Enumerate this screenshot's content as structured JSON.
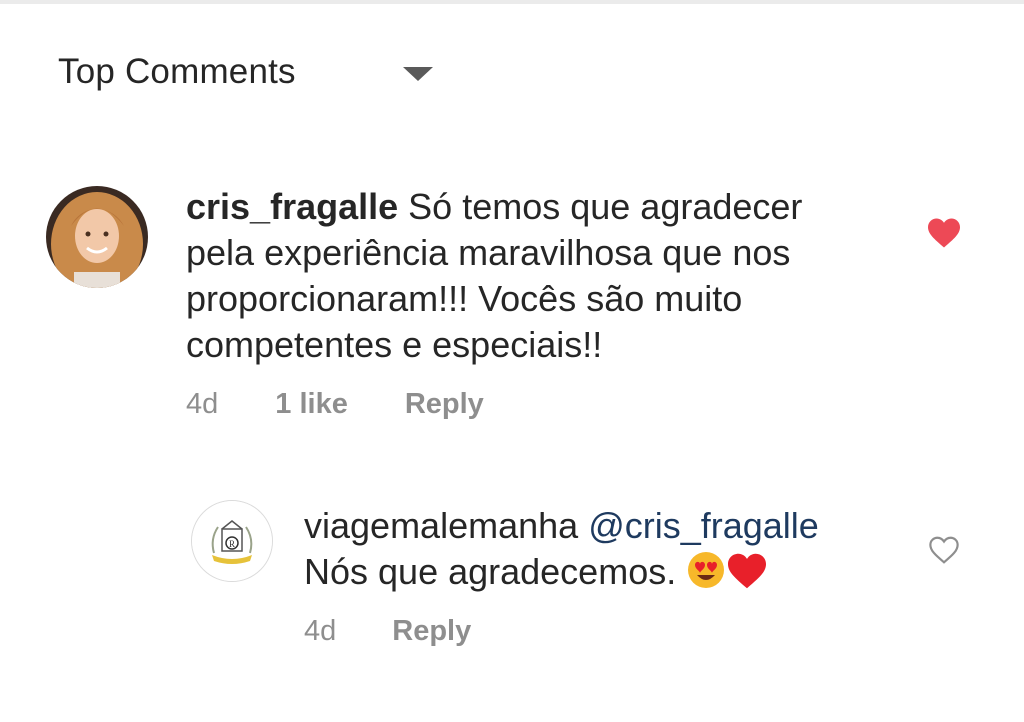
{
  "header": {
    "sort_label": "Top Comments"
  },
  "comments": [
    {
      "username": "cris_fragalle",
      "text": "Só temos que agradecer pela experiência maravilhosa que nos proporcionaram!!! Vocês são muito competentes e especiais!!",
      "lines": [
        "Só temos que agradecer",
        "pela experiência maravilhosa que nos",
        "proporcionaram!!! Vocês são muito",
        "competentes e especiais!!"
      ],
      "time": "4d",
      "likes": "1 like",
      "reply_label": "Reply",
      "liked": true
    },
    {
      "username": "viagemalemanha",
      "mention": "@cris_fragalle",
      "text": "Nós que agradecemos.",
      "time": "4d",
      "reply_label": "Reply",
      "liked": false
    }
  ],
  "colors": {
    "liked_heart": "#ed4956",
    "meta_gray": "#8e8e8e",
    "text": "#262626",
    "mention": "#1e3a5f"
  }
}
